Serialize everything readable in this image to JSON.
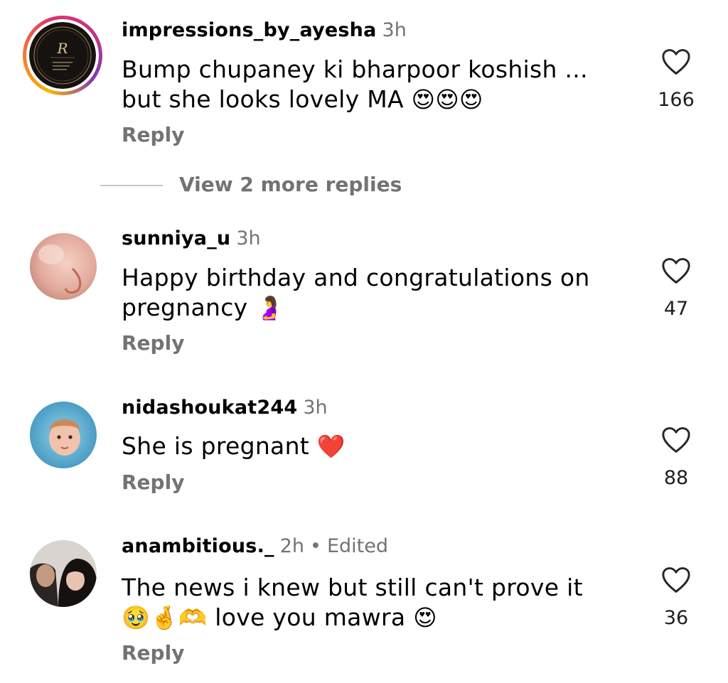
{
  "comments": [
    {
      "username": "impressions_by_ayesha",
      "time": "3h",
      "edited": "",
      "text_line1": "Bump chupaney ki bharpoor koshish ...",
      "text_line2": "but she looks lovely MA",
      "emojis_line2": "😍😍😍",
      "emojis_line1": "",
      "likes": "166",
      "reply_label": "Reply",
      "avatar_icon": "brand-logo-avatar",
      "has_story_ring": true
    },
    {
      "username": "sunniya_u",
      "time": "3h",
      "edited": "",
      "text_line1": "Happy birthday and congratulations on",
      "text_line2": "pregnancy",
      "emojis_line2": "🤰",
      "likes": "47",
      "reply_label": "Reply",
      "avatar_icon": "photo-avatar"
    },
    {
      "username": "nidashoukat244",
      "time": "3h",
      "edited": "",
      "text_line1": "She is pregnant",
      "emojis_line1": "❤️",
      "likes": "88",
      "reply_label": "Reply",
      "avatar_icon": "photo-avatar"
    },
    {
      "username": "anambitious._",
      "time": "2h",
      "separator": "•",
      "edited": "Edited",
      "text_line1": "The news i knew but still can't prove it",
      "emojis_line2_prefix": "🥹🤞🫶",
      "text_line2": "love you mawra",
      "emojis_line2": "😍",
      "likes": "36",
      "reply_label": "Reply",
      "avatar_icon": "photo-avatar"
    }
  ],
  "view_more": {
    "label": "View 2 more replies"
  },
  "icons": {
    "like": "heart-outline-icon"
  },
  "colors": {
    "secondary_text": "#737373",
    "primary_text": "#000000",
    "story_ring": [
      "#f7b500",
      "#e1306c",
      "#833ab4"
    ]
  }
}
